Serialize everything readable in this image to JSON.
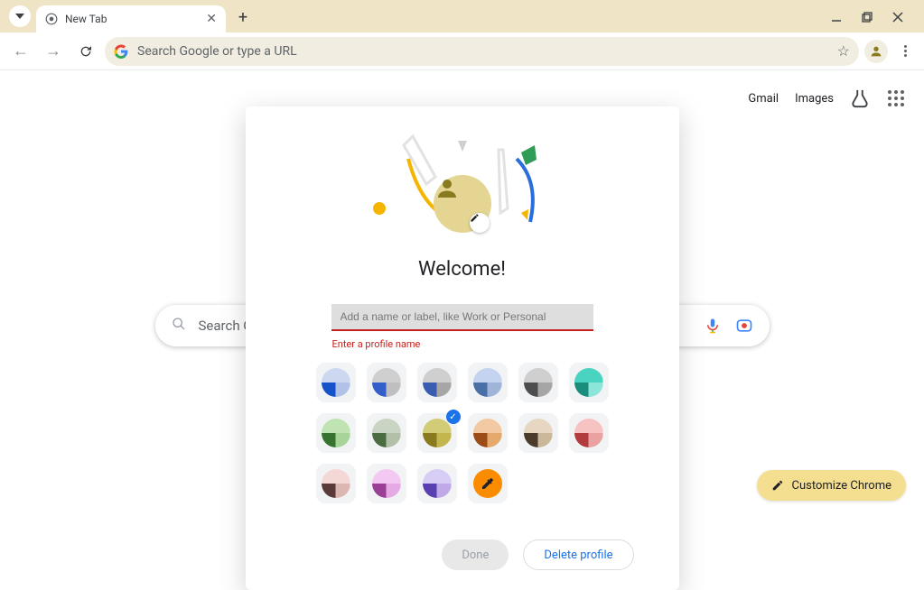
{
  "tab": {
    "title": "New Tab"
  },
  "omnibox": {
    "placeholder": "Search Google or type a URL"
  },
  "ntp": {
    "gmail": "Gmail",
    "images": "Images",
    "search_placeholder": "Search Google or type a URL",
    "customize": "Customize Chrome"
  },
  "modal": {
    "title": "Welcome!",
    "name_placeholder": "Add a name or label, like Work or Personal",
    "error": "Enter a profile name",
    "done": "Done",
    "delete": "Delete profile",
    "selected_index": 8,
    "swatches": [
      {
        "top": "#cdd8f0",
        "bl": "#1652c9",
        "br": "#b2c2e6"
      },
      {
        "top": "#cfcfcf",
        "bl": "#345ec9",
        "br": "#bfbfbf"
      },
      {
        "top": "#cfcfcf",
        "bl": "#3b5db1",
        "br": "#a6a6a6"
      },
      {
        "top": "#c3d3f0",
        "bl": "#4a6fa7",
        "br": "#9fb4d8"
      },
      {
        "top": "#cfcfcf",
        "bl": "#4e4e4e",
        "br": "#a6a6a6"
      },
      {
        "top": "#4bd3c2",
        "bl": "#1b8d7c",
        "br": "#8de4d8"
      },
      {
        "top": "#c0e3b3",
        "bl": "#35732e",
        "br": "#a8d49a"
      },
      {
        "top": "#c9d4c3",
        "bl": "#4a6c3f",
        "br": "#b2c0a9"
      },
      {
        "top": "#d2cc77",
        "bl": "#8a7a1f",
        "br": "#c4b64e"
      },
      {
        "top": "#f2c9a3",
        "bl": "#9c4c17",
        "br": "#e5a96d"
      },
      {
        "top": "#e6d6c2",
        "bl": "#4a3b2b",
        "br": "#cbb79a"
      },
      {
        "top": "#f6c3c2",
        "bl": "#b13c3e",
        "br": "#eaa1a1"
      },
      {
        "top": "#f4d8d5",
        "bl": "#5a3a38",
        "br": "#dcb7b2"
      },
      {
        "top": "#f3c9f1",
        "bl": "#9a3f96",
        "br": "#e5a9e3"
      },
      {
        "top": "#d8cdf4",
        "bl": "#5a3fb1",
        "br": "#bfa9e6"
      }
    ]
  }
}
